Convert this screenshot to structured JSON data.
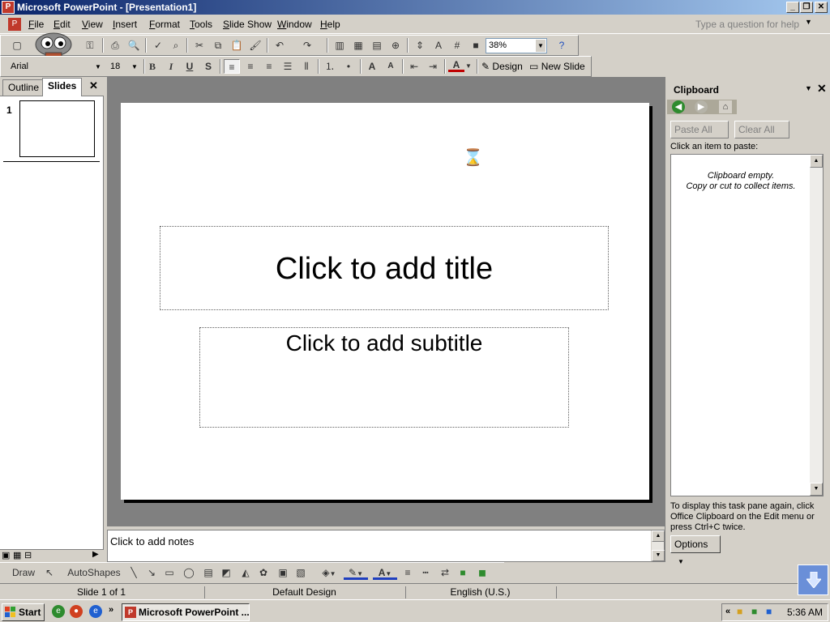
{
  "window": {
    "title": "Microsoft PowerPoint - [Presentation1]",
    "buttons": {
      "minimize": "_",
      "restore": "❐",
      "close": "✕"
    }
  },
  "menu": {
    "items": [
      "File",
      "Edit",
      "View",
      "Insert",
      "Format",
      "Tools",
      "Slide Show",
      "Window",
      "Help"
    ],
    "ask_placeholder": "Type a question for help"
  },
  "standard_toolbar": {
    "zoom": "38%"
  },
  "formatting_toolbar": {
    "font": "Arial",
    "font_size": "18",
    "bold": "B",
    "italic": "I",
    "underline": "U",
    "shadow": "S",
    "design_label": "Design",
    "new_slide_label": "New Slide"
  },
  "left_pane": {
    "tabs": [
      "Outline",
      "Slides"
    ],
    "active_tab": "Slides",
    "slide_number": "1"
  },
  "slide": {
    "title_placeholder": "Click to add title",
    "subtitle_placeholder": "Click to add subtitle"
  },
  "notes": {
    "placeholder": "Click to add notes"
  },
  "task_pane": {
    "title": "Clipboard",
    "paste_all": "Paste All",
    "clear_all": "Clear All",
    "click_label": "Click an item to paste:",
    "empty_line1": "Clipboard empty.",
    "empty_line2": "Copy or cut to collect items.",
    "help_text": "To display this task pane again, click Office Clipboard on the Edit menu or press Ctrl+C twice.",
    "options": "Options"
  },
  "drawing_toolbar": {
    "draw": "Draw",
    "autoshapes": "AutoShapes"
  },
  "status_bar": {
    "slide": "Slide 1 of 1",
    "design": "Default Design",
    "language": "English (U.S.)"
  },
  "taskbar": {
    "start": "Start",
    "task": "Microsoft PowerPoint ...",
    "clock": "5:36 AM"
  },
  "colors": {
    "title_gradient_start": "#0a246a",
    "title_gradient_end": "#a6caf0",
    "chrome": "#d4d0c8",
    "workspace": "#808080"
  }
}
